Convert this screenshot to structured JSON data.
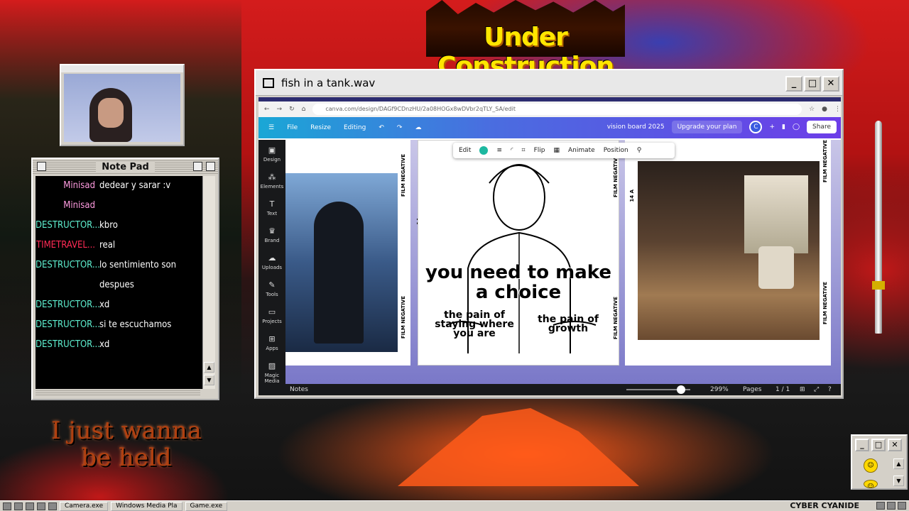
{
  "background": {
    "banner_text": "Under Construction",
    "caption_line1": "I just wanna",
    "caption_line2": "be held"
  },
  "camera_window": {
    "title": "Camera.exe"
  },
  "notepad": {
    "title": "Note Pad",
    "messages": [
      {
        "user": "Minisad",
        "text": "dedear y sarar :v",
        "color": "#ff9be0"
      },
      {
        "user": "Minisad",
        "text": "",
        "color": "#ff9be0"
      },
      {
        "user": "DESTRUCTOR...",
        "text": "kbro",
        "color": "#5ef0d0"
      },
      {
        "user": "TIMETRAVEL...",
        "text": "real",
        "color": "#ff2a55"
      },
      {
        "user": "DESTRUCTOR...",
        "text": "lo sentimiento son",
        "color": "#5ef0d0"
      },
      {
        "user": "",
        "text": "despues",
        "color": "#5ef0d0"
      },
      {
        "user": "DESTRUCTOR...",
        "text": "xd",
        "color": "#5ef0d0"
      },
      {
        "user": "DESTRUCTOR...",
        "text": "si te escuchamos",
        "color": "#5ef0d0"
      },
      {
        "user": "DESTRUCTOR...",
        "text": "xd",
        "color": "#5ef0d0"
      }
    ]
  },
  "main_window": {
    "title": "fish in a tank.wav",
    "url": "canva.com/design/DAGf9CDnzHU/2a08HOGx8wDVbr2qTLY_SA/edit",
    "canva": {
      "menu_file": "File",
      "menu_resize": "Resize",
      "menu_editing": "Editing",
      "doc_title": "vision board 2025",
      "upgrade": "Upgrade your plan",
      "avatar": "C",
      "share": "Share",
      "sidebar": [
        "Design",
        "Elements",
        "Text",
        "Brand",
        "Uploads",
        "Tools",
        "Projects",
        "Apps",
        "Magic Media"
      ],
      "toolbar": [
        "Edit",
        "Flip",
        "Animate",
        "Position"
      ],
      "film_label": "FILM NEGATIVE",
      "film_num": "14",
      "film_num_a": "14 A",
      "meme_main": "you need to make a choice",
      "meme_left": "the pain of staying where you are",
      "meme_right": "the pain of growth",
      "notes": "Notes",
      "zoom": "299%",
      "zoom_fraction": 0.85,
      "pages_label": "Pages",
      "pages": "1 / 1"
    }
  },
  "taskbar": {
    "items": [
      "Camera.exe",
      "Windows Media Pla",
      "Game.exe"
    ],
    "brand": "CYBER CYANIDE"
  }
}
